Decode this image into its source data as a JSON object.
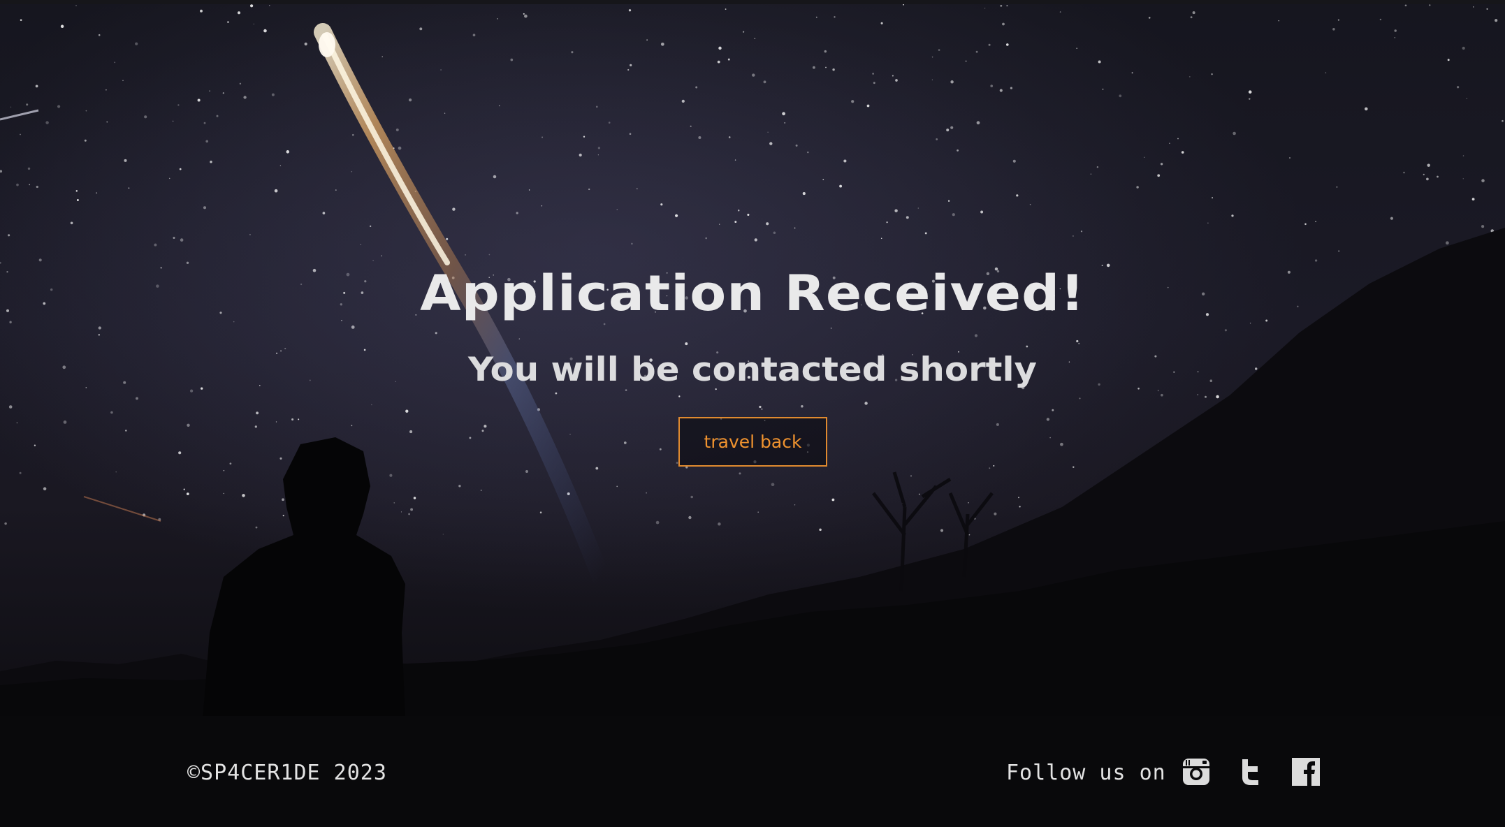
{
  "hero": {
    "title": "Application Received!",
    "subtitle": "You will be contacted shortly",
    "button_label": "travel back"
  },
  "footer": {
    "copyright": "©SP4CER1DE 2023",
    "follow_label": "Follow us on",
    "social": [
      {
        "name": "instagram",
        "icon": "instagram-icon"
      },
      {
        "name": "twitter",
        "icon": "twitter-icon"
      },
      {
        "name": "facebook",
        "icon": "facebook-icon"
      }
    ]
  },
  "colors": {
    "accent": "#f0932f",
    "text": "#e9e9ea",
    "footer_bg": "#09090b"
  }
}
